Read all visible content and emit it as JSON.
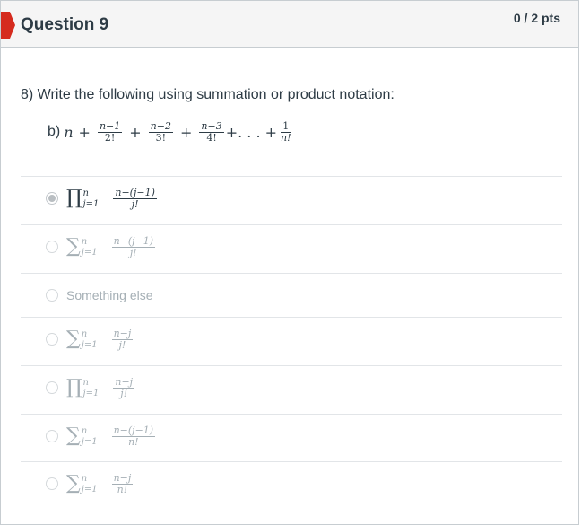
{
  "question": {
    "title": "Question 9",
    "points": "0 / 2 pts",
    "prompt": "8) Write the following using summation or product notation:",
    "expression": {
      "label": "b)",
      "var": "n",
      "plus": "+",
      "terms": [
        {
          "num": "n−1",
          "den": "2!"
        },
        {
          "num": "n−2",
          "den": "3!"
        },
        {
          "num": "n−3",
          "den": "4!"
        }
      ],
      "ellipsis": "+. . . +",
      "last": {
        "num": "1",
        "den": "n!"
      }
    }
  },
  "answers": [
    {
      "op": "∏",
      "upper": "n",
      "lower": "j=1",
      "num": "n−(j−1)",
      "den": "j!",
      "selected": true
    },
    {
      "op": "∑",
      "upper": "n",
      "lower": "j=1",
      "num": "n−(j−1)",
      "den": "j!",
      "selected": false
    },
    {
      "text": "Something else",
      "selected": false
    },
    {
      "op": "∑",
      "upper": "n",
      "lower": "j=1",
      "num": "n−j",
      "den": "j!",
      "selected": false
    },
    {
      "op": "∏",
      "upper": "n",
      "lower": "j=1",
      "num": "n−j",
      "den": "j!",
      "selected": false
    },
    {
      "op": "∑",
      "upper": "n",
      "lower": "j=1",
      "num": "n−(j−1)",
      "den": "n!",
      "selected": false
    },
    {
      "op": "∑",
      "upper": "n",
      "lower": "j=1",
      "num": "n−j",
      "den": "n!",
      "selected": false
    }
  ],
  "colors": {
    "flag": "#d52b1e",
    "text": "#2d3b45",
    "muted": "#a5afb5",
    "divider": "#e2e5e8"
  },
  "icons": {
    "flag": "flag-icon",
    "radio_selected": "radio-selected-icon",
    "radio": "radio-icon"
  }
}
